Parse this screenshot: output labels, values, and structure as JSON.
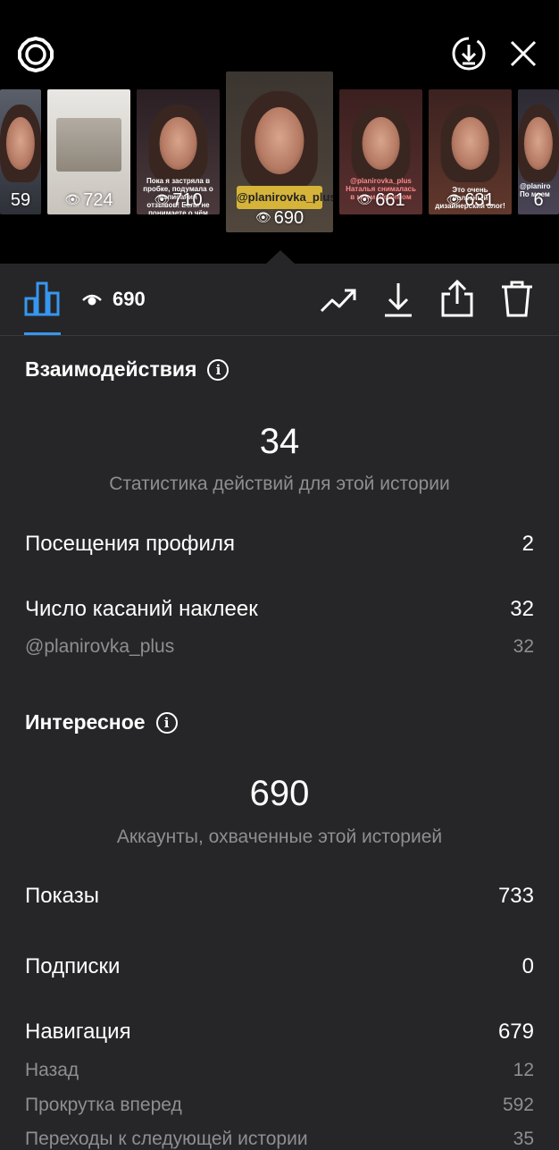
{
  "header": {
    "settings_icon": "gear-icon",
    "download_icon": "circle-download-icon",
    "close_icon": "close-icon"
  },
  "stories": [
    {
      "count": "59",
      "caption": ""
    },
    {
      "count": "724",
      "caption": ""
    },
    {
      "count": "710",
      "caption": "Пока я застряла в пробке, подумала о написании отзывов! Если не понимаете о чём речь, читайте новый пост"
    },
    {
      "count": "690",
      "sticker": "@planirovka_plus",
      "selected": true
    },
    {
      "count": "661",
      "caption": "@planirovka_plus Наталья снималась в моем любимом"
    },
    {
      "count": "631",
      "caption": "Это очень полезный дизайнерский блог!"
    },
    {
      "count": "6",
      "caption": "@planiro По моем"
    }
  ],
  "toolbar": {
    "views": "690",
    "chart_icon": "bar-chart-icon",
    "trend_icon": "trending-up-icon",
    "save_icon": "download-icon",
    "share_icon": "share-icon",
    "delete_icon": "trash-icon"
  },
  "interactions": {
    "title": "Взаимодействия",
    "total": "34",
    "subtitle": "Статистика действий для этой истории",
    "rows": [
      {
        "label": "Посещения профиля",
        "value": "2"
      },
      {
        "label": "Число касаний наклеек",
        "value": "32"
      },
      {
        "label": "@planirovka_plus",
        "value": "32"
      }
    ]
  },
  "discovery": {
    "title": "Интересное",
    "total": "690",
    "subtitle": "Аккаунты, охваченные этой историей",
    "rows": [
      {
        "label": "Показы",
        "value": "733"
      },
      {
        "label": "Подписки",
        "value": "0"
      },
      {
        "label": "Навигация",
        "value": "679"
      },
      {
        "label": "Назад",
        "value": "12"
      },
      {
        "label": "Прокрутка вперед",
        "value": "592"
      },
      {
        "label": "Переходы к следующей истории",
        "value": "35"
      }
    ]
  }
}
